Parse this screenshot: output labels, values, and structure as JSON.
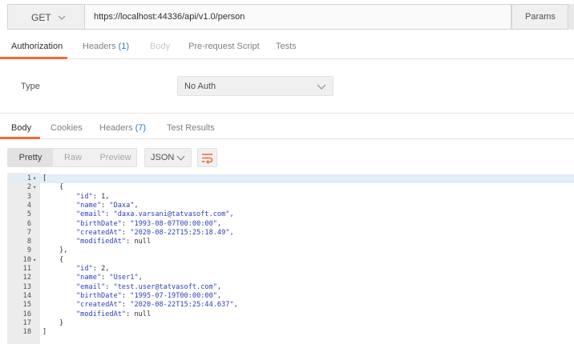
{
  "request": {
    "method": "GET",
    "url": "https://localhost:44336/api/v1.0/person",
    "params_label": "Params"
  },
  "request_tabs": [
    {
      "label": "Authorization",
      "count": "",
      "state": "active"
    },
    {
      "label": "Headers",
      "count": "(1)",
      "state": "normal"
    },
    {
      "label": "Body",
      "count": "",
      "state": "disabled"
    },
    {
      "label": "Pre-request Script",
      "count": "",
      "state": "normal"
    },
    {
      "label": "Tests",
      "count": "",
      "state": "normal"
    }
  ],
  "auth": {
    "type_label": "Type",
    "type_value": "No Auth"
  },
  "response_tabs": [
    {
      "label": "Body",
      "count": "",
      "state": "active"
    },
    {
      "label": "Cookies",
      "count": "",
      "state": "normal"
    },
    {
      "label": "Headers",
      "count": "(7)",
      "state": "normal"
    },
    {
      "label": "Test Results",
      "count": "",
      "state": "normal"
    }
  ],
  "toolbar": {
    "views": [
      "Pretty",
      "Raw",
      "Preview"
    ],
    "active_view": "Pretty",
    "format": "JSON",
    "wrap_icon": "wrap-lines-icon"
  },
  "code_lines": [
    {
      "n": "1",
      "fold": true,
      "indent": 0,
      "key": "",
      "value": "[",
      "vtype": "p"
    },
    {
      "n": "2",
      "fold": true,
      "indent": 1,
      "key": "",
      "value": "{",
      "vtype": "p"
    },
    {
      "n": "3",
      "fold": false,
      "indent": 2,
      "key": "\"id\"",
      "value": "1,",
      "vtype": "n"
    },
    {
      "n": "4",
      "fold": false,
      "indent": 2,
      "key": "\"name\"",
      "value": "\"Daxa\",",
      "vtype": "s"
    },
    {
      "n": "5",
      "fold": false,
      "indent": 2,
      "key": "\"email\"",
      "value": "\"daxa.varsani@tatvasoft.com\",",
      "vtype": "s"
    },
    {
      "n": "6",
      "fold": false,
      "indent": 2,
      "key": "\"birthDate\"",
      "value": "\"1993-08-07T00:00:00\",",
      "vtype": "s"
    },
    {
      "n": "7",
      "fold": false,
      "indent": 2,
      "key": "\"createdAt\"",
      "value": "\"2020-08-22T15:25:18.49\",",
      "vtype": "s"
    },
    {
      "n": "8",
      "fold": false,
      "indent": 2,
      "key": "\"modifiedAt\"",
      "value": "null",
      "vtype": "n"
    },
    {
      "n": "9",
      "fold": false,
      "indent": 1,
      "key": "",
      "value": "},",
      "vtype": "p"
    },
    {
      "n": "10",
      "fold": true,
      "indent": 1,
      "key": "",
      "value": "{",
      "vtype": "p"
    },
    {
      "n": "11",
      "fold": false,
      "indent": 2,
      "key": "\"id\"",
      "value": "2,",
      "vtype": "n"
    },
    {
      "n": "12",
      "fold": false,
      "indent": 2,
      "key": "\"name\"",
      "value": "\"User1\",",
      "vtype": "s"
    },
    {
      "n": "13",
      "fold": false,
      "indent": 2,
      "key": "\"email\"",
      "value": "\"test.user@tatvasoft.com\",",
      "vtype": "s"
    },
    {
      "n": "14",
      "fold": false,
      "indent": 2,
      "key": "\"birthDate\"",
      "value": "\"1995-07-19T00:00:00\",",
      "vtype": "s"
    },
    {
      "n": "15",
      "fold": false,
      "indent": 2,
      "key": "\"createdAt\"",
      "value": "\"2020-08-22T15:25:44.637\",",
      "vtype": "s"
    },
    {
      "n": "16",
      "fold": false,
      "indent": 2,
      "key": "\"modifiedAt\"",
      "value": "null",
      "vtype": "n"
    },
    {
      "n": "17",
      "fold": false,
      "indent": 1,
      "key": "",
      "value": "}",
      "vtype": "p"
    },
    {
      "n": "18",
      "fold": false,
      "indent": 0,
      "key": "",
      "value": "]",
      "vtype": "p"
    }
  ],
  "colors": {
    "accent": "#f26b3a",
    "count": "#2a7cc7",
    "json_key": "#2e3fb6",
    "json_string": "#2e3fb6",
    "current_line": "#e4ecf7"
  }
}
